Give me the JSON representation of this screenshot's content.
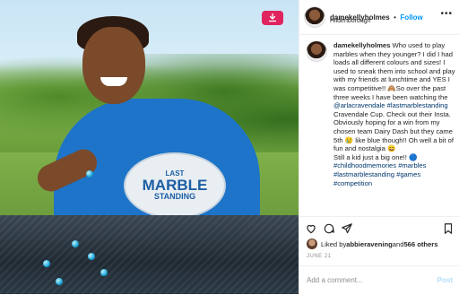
{
  "post": {
    "username": "damekellyholmes",
    "location": "Hildenborough",
    "follow_separator": "•",
    "follow_label": "Follow",
    "badge": {
      "line1": "LAST",
      "line2": "MARBLE",
      "line3": "STANDING"
    },
    "caption": {
      "username": "damekellyholmes",
      "text_1": "Who used to play marbles when they younger? I did I had loads all different colours and sizes! I used to sneak them into school and play with my friends at lunchtime and YES I was competitive!! 🙈So over the past three weeks I have been watching the ",
      "tag_1": "@arlacravendale",
      "text_2": " ",
      "tag_2": "#lastmarblestanding",
      "text_3": " Cravendale Cup. Check out their Insta. Obviously hoping for a win from my chosen team Dairy Dash but they came 5th 😢 like blue though!! Oh well a bit of fun and nostalgia 😄",
      "text_4": "Still a kid just a big one!! 🔵",
      "tag_3": "#childhoodmemories",
      "tag_4": "#marbles",
      "tag_5": "#lastmarblestanding",
      "tag_6": "#games",
      "tag_7": "#competition"
    },
    "likes": {
      "prefix": "Liked by ",
      "user": "abbieravening",
      "middle": " and ",
      "count": "566 others"
    },
    "date": "JUNE 21",
    "comment_placeholder": "Add a comment...",
    "post_label": "Post",
    "icons": [
      "heart-icon",
      "comment-icon",
      "share-icon",
      "bookmark-icon",
      "more-icon",
      "save-to-pinterest-icon"
    ],
    "colors": {
      "link": "#0095f6",
      "hashtag": "#00376b",
      "save": "#e0245e"
    }
  }
}
